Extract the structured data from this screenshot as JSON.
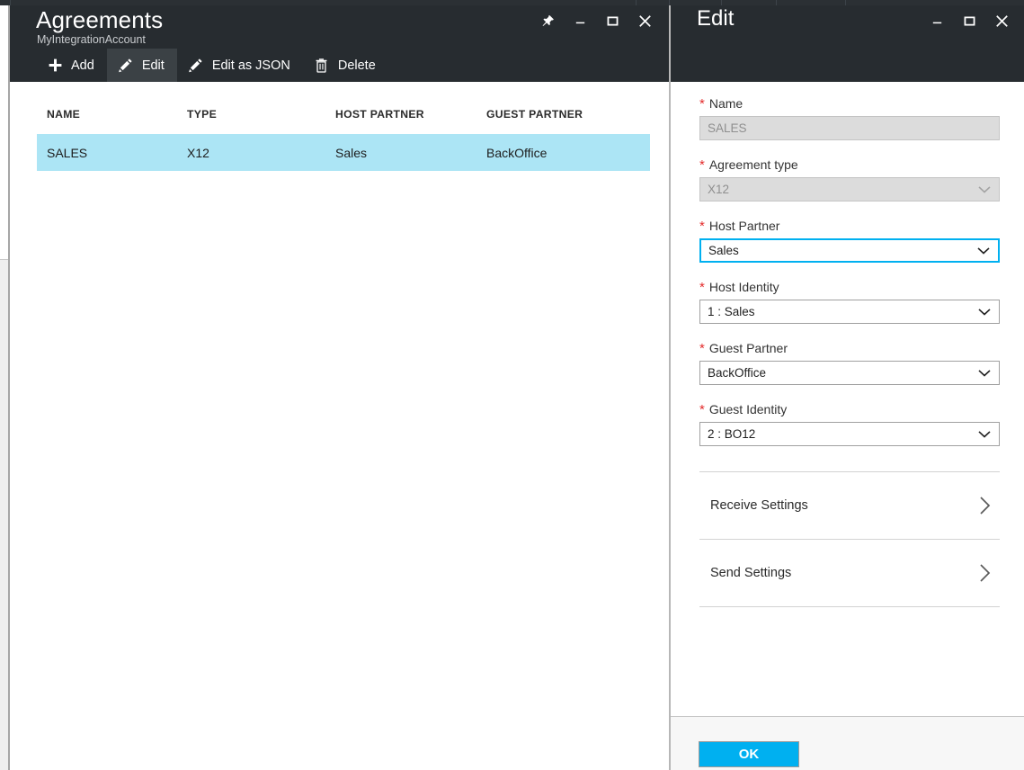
{
  "colors": {
    "blade_header_bg": "#272c30",
    "toolbar_active_bg": "#3b4145",
    "row_selected_bg": "#ace5f5",
    "accent": "#00b0f0",
    "required_asterisk": "#e32c2c",
    "disabled_field_bg": "#dcdcdc",
    "footer_bg": "#f7f7f7"
  },
  "left_blade": {
    "title": "Agreements",
    "subtitle": "MyIntegrationAccount",
    "window_controls": [
      {
        "name": "pin-icon",
        "label": "Pin"
      },
      {
        "name": "minimize-icon",
        "label": "Minimize"
      },
      {
        "name": "maximize-icon",
        "label": "Maximize"
      },
      {
        "name": "close-icon",
        "label": "Close"
      }
    ],
    "toolbar": [
      {
        "label": "Add",
        "icon": "plus-icon",
        "active": false
      },
      {
        "label": "Edit",
        "icon": "pencil-icon",
        "active": true
      },
      {
        "label": "Edit as JSON",
        "icon": "pencil-icon",
        "active": false
      },
      {
        "label": "Delete",
        "icon": "trash-icon",
        "active": false
      }
    ],
    "grid": {
      "columns": [
        "NAME",
        "TYPE",
        "HOST PARTNER",
        "GUEST PARTNER"
      ],
      "rows": [
        {
          "name": "SALES",
          "type": "X12",
          "host_partner": "Sales",
          "guest_partner": "BackOffice",
          "selected": true
        }
      ]
    }
  },
  "right_blade": {
    "title": "Edit",
    "window_controls": [
      {
        "name": "minimize-icon",
        "label": "Minimize"
      },
      {
        "name": "maximize-icon",
        "label": "Maximize"
      },
      {
        "name": "close-icon",
        "label": "Close"
      }
    ],
    "fields": [
      {
        "label": "Name",
        "value": "SALES",
        "required": true,
        "kind": "text",
        "state": "disabled"
      },
      {
        "label": "Agreement type",
        "value": "X12",
        "required": true,
        "kind": "select",
        "state": "disabled"
      },
      {
        "label": "Host Partner",
        "value": "Sales",
        "required": true,
        "kind": "select",
        "state": "focused"
      },
      {
        "label": "Host Identity",
        "value": "1 : Sales",
        "required": true,
        "kind": "select",
        "state": "normal"
      },
      {
        "label": "Guest Partner",
        "value": "BackOffice",
        "required": true,
        "kind": "select",
        "state": "normal"
      },
      {
        "label": "Guest Identity",
        "value": "2 : BO12",
        "required": true,
        "kind": "select",
        "state": "normal"
      }
    ],
    "sections": [
      {
        "label": "Receive Settings",
        "icon": "chevron-right-icon"
      },
      {
        "label": "Send Settings",
        "icon": "chevron-right-icon"
      }
    ],
    "footer": {
      "ok_label": "OK"
    }
  }
}
